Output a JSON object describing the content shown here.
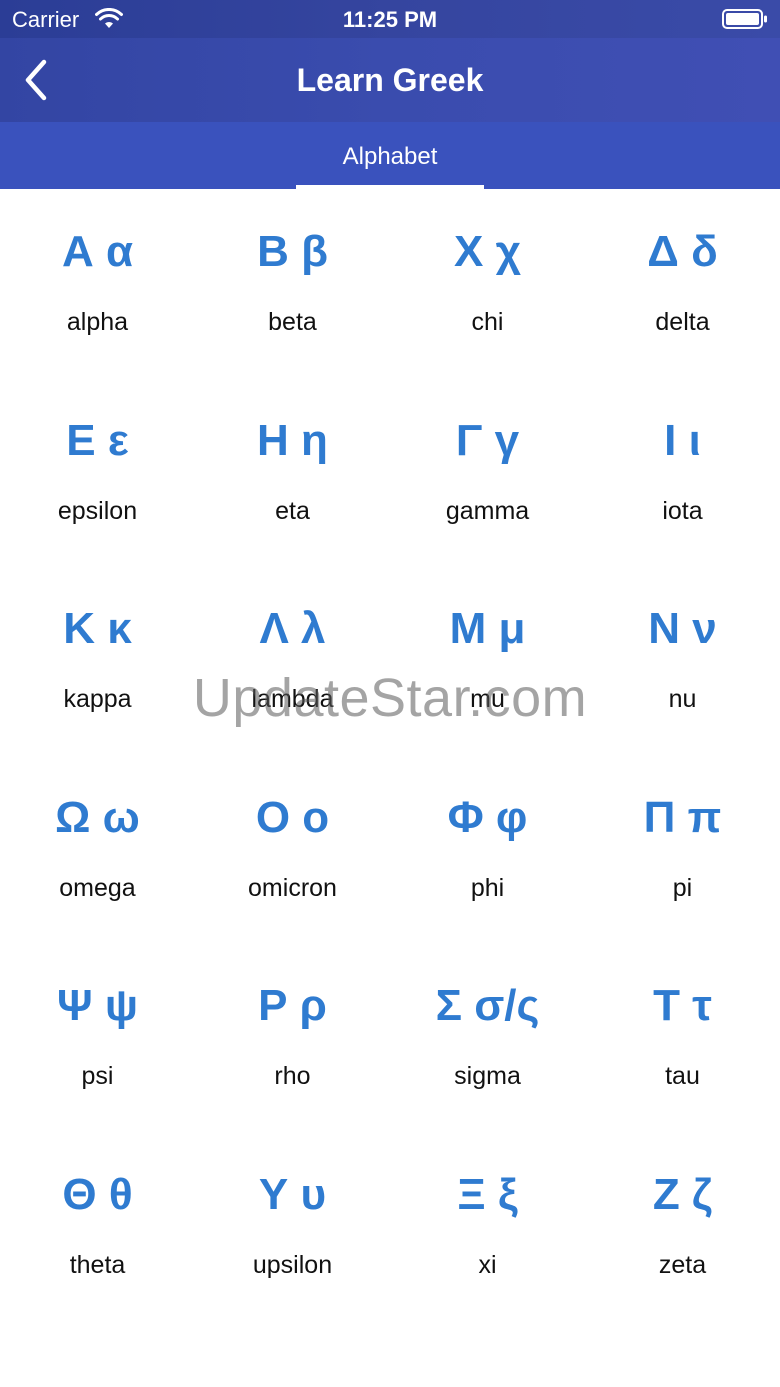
{
  "status_bar": {
    "carrier": "Carrier",
    "time": "11:25 PM",
    "icons": [
      "wifi-icon",
      "battery-icon"
    ]
  },
  "nav": {
    "title": "Learn Greek",
    "back_icon": "chevron-left-icon"
  },
  "tabs": [
    {
      "label": "Alphabet",
      "active": true
    }
  ],
  "colors": {
    "header": "#3a4cae",
    "tab_bar": "#3a52bd",
    "letter": "#2f7bd0",
    "name": "#111111"
  },
  "letters": [
    {
      "glyph": "Α α",
      "name": "alpha"
    },
    {
      "glyph": "Β β",
      "name": "beta"
    },
    {
      "glyph": "Χ χ",
      "name": "chi"
    },
    {
      "glyph": "Δ δ",
      "name": "delta"
    },
    {
      "glyph": "Ε ε",
      "name": "epsilon"
    },
    {
      "glyph": "Η η",
      "name": "eta"
    },
    {
      "glyph": "Γ γ",
      "name": "gamma"
    },
    {
      "glyph": "Ι ι",
      "name": "iota"
    },
    {
      "glyph": "Κ κ",
      "name": "kappa"
    },
    {
      "glyph": "Λ λ",
      "name": "lambda"
    },
    {
      "glyph": "Μ μ",
      "name": "mu"
    },
    {
      "glyph": "Ν ν",
      "name": "nu"
    },
    {
      "glyph": "Ω ω",
      "name": "omega"
    },
    {
      "glyph": "Ο ο",
      "name": "omicron"
    },
    {
      "glyph": "Φ φ",
      "name": "phi"
    },
    {
      "glyph": "Π π",
      "name": "pi"
    },
    {
      "glyph": "Ψ ψ",
      "name": "psi"
    },
    {
      "glyph": "Ρ ρ",
      "name": "rho"
    },
    {
      "glyph": "Σ σ/ς",
      "name": "sigma"
    },
    {
      "glyph": "Τ τ",
      "name": "tau"
    },
    {
      "glyph": "Θ θ",
      "name": "theta"
    },
    {
      "glyph": "Υ υ",
      "name": "upsilon"
    },
    {
      "glyph": "Ξ ξ",
      "name": "xi"
    },
    {
      "glyph": "Ζ ζ",
      "name": "zeta"
    }
  ],
  "watermark": "UpdateStar.com"
}
